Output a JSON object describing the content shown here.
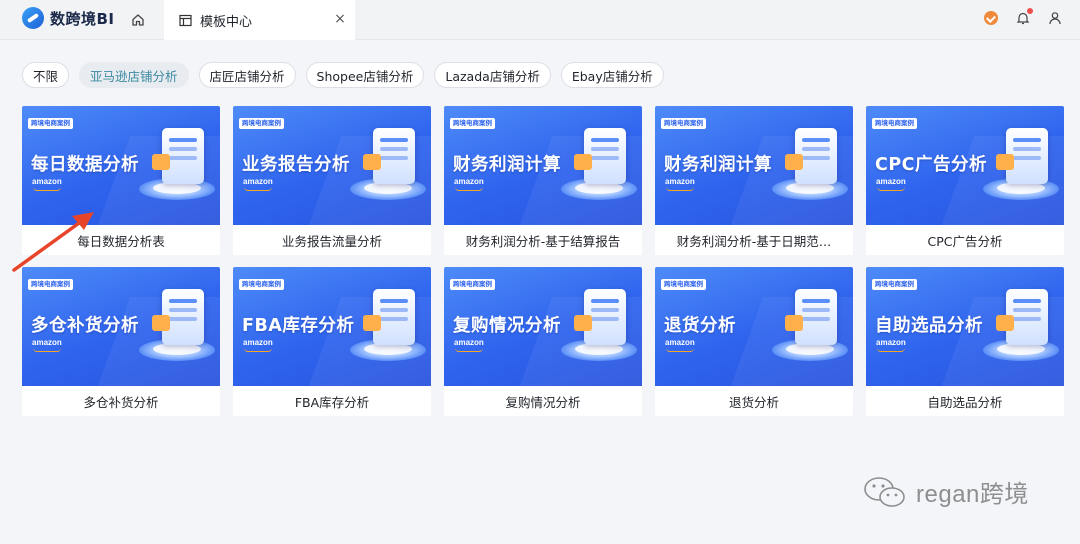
{
  "app": {
    "name": "数跨境BI"
  },
  "header": {
    "tab_label": "模板中心",
    "tab_close": "×"
  },
  "filters": [
    {
      "label": "不限",
      "active": false
    },
    {
      "label": "亚马逊店铺分析",
      "active": true
    },
    {
      "label": "店匠店铺分析",
      "active": false
    },
    {
      "label": "Shopee店铺分析",
      "active": false
    },
    {
      "label": "Lazada店铺分析",
      "active": false
    },
    {
      "label": "Ebay店铺分析",
      "active": false
    }
  ],
  "cards": [
    {
      "tag": "跨境电商案例",
      "title": "每日数据分析",
      "brand": "amazon",
      "label": "每日数据分析表"
    },
    {
      "tag": "跨境电商案例",
      "title": "业务报告分析",
      "brand": "amazon",
      "label": "业务报告流量分析"
    },
    {
      "tag": "跨境电商案例",
      "title": "财务利润计算",
      "brand": "amazon",
      "label": "财务利润分析-基于结算报告"
    },
    {
      "tag": "跨境电商案例",
      "title": "财务利润计算",
      "brand": "amazon",
      "label": "财务利润分析-基于日期范…"
    },
    {
      "tag": "跨境电商案例",
      "title": "CPC广告分析",
      "brand": "amazon",
      "label": "CPC广告分析"
    },
    {
      "tag": "跨境电商案例",
      "title": "多仓补货分析",
      "brand": "amazon",
      "label": "多仓补货分析"
    },
    {
      "tag": "跨境电商案例",
      "title": "FBA库存分析",
      "brand": "amazon",
      "label": "FBA库存分析"
    },
    {
      "tag": "跨境电商案例",
      "title": "复购情况分析",
      "brand": "amazon",
      "label": "复购情况分析"
    },
    {
      "tag": "跨境电商案例",
      "title": "退货分析",
      "brand": "amazon",
      "label": "退货分析"
    },
    {
      "tag": "跨境电商案例",
      "title": "自助选品分析",
      "brand": "amazon",
      "label": "自助选品分析"
    }
  ],
  "watermark": {
    "text": "regan跨境"
  },
  "colors": {
    "accent": "#2e63ee",
    "arrow": "#e8442a",
    "active_chip_text": "#3c8aa0"
  }
}
